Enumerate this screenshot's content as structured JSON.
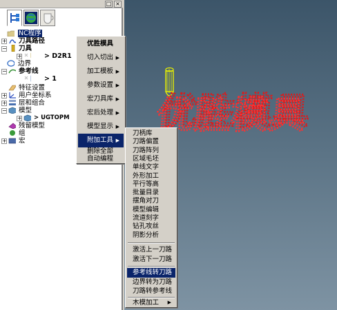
{
  "panel": {
    "tabs": [
      "toolpath-tree-icon",
      "globe-icon",
      "cup-icon"
    ],
    "window_buttons": [
      "□",
      "×"
    ],
    "tree": [
      {
        "label": "NC程序",
        "selected": true
      },
      {
        "label": "刀具路径",
        "bold": true
      },
      {
        "label": "刀具",
        "bold": true
      },
      {
        "label": "> D2R1",
        "bold": true
      },
      {
        "label": "边界"
      },
      {
        "label": "参考线",
        "bold": true
      },
      {
        "label": "> 1",
        "bold": true
      },
      {
        "label": "特征设置"
      },
      {
        "label": "用户坐标系"
      },
      {
        "label": "层和组合"
      },
      {
        "label": "模型"
      },
      {
        "label": "> UGTOPM",
        "bold": true
      },
      {
        "label": "残留模型"
      },
      {
        "label": "组"
      },
      {
        "label": "宏"
      }
    ]
  },
  "viewport": {
    "model_text": "优胜模具",
    "model_color": "#e01818",
    "tool_color": "#e8f000"
  },
  "main_menu": {
    "items": [
      {
        "label": "优胜模具",
        "bold": true,
        "arrow": false
      },
      {
        "label": "切入切出",
        "arrow": true
      },
      {
        "label": "加工模板",
        "arrow": true
      },
      {
        "label": "参数设置",
        "arrow": true
      },
      {
        "label": "宏刀具库",
        "arrow": true
      },
      {
        "label": "宏后处理",
        "arrow": true
      },
      {
        "label": "模型显示",
        "arrow": true
      },
      {
        "label": "附加工具",
        "arrow": true,
        "highlighted": true
      },
      {
        "label": "删除全部",
        "arrow": false
      },
      {
        "label": "自动编程",
        "arrow": false
      }
    ],
    "arrow_glyph": "▶"
  },
  "sub_menu": {
    "group1": [
      "刀柄库",
      "刀路偏置",
      "刀路阵列",
      "区域毛坯",
      "单线文字",
      "外形加工",
      "平行等高",
      "批量目录",
      "摆角对刀",
      "模型编辑",
      "流道刻字",
      "钻孔攻丝",
      "阴影分析"
    ],
    "group2": [
      "激活上一刀路",
      "激活下一刀路"
    ],
    "group3": [
      "参考线转刀路",
      "边界转为刀路",
      "刀路转参考线"
    ],
    "highlighted": "参考线转刀路",
    "group4": [
      {
        "label": "木模加工",
        "arrow": true
      }
    ]
  }
}
